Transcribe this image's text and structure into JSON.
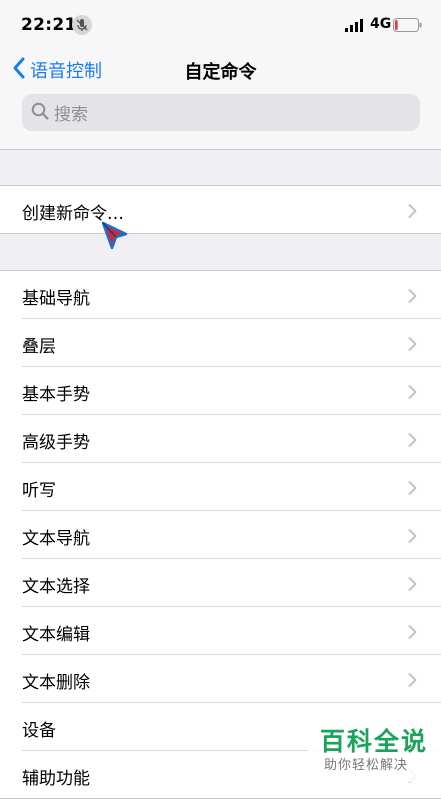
{
  "status_bar": {
    "time": "22:21",
    "network": "4G",
    "battery_level": 0.12,
    "battery_color": "#e0393e"
  },
  "nav": {
    "back_label": "语音控制",
    "title": "自定命令",
    "accent": "#1a7cf5"
  },
  "search": {
    "placeholder": "搜索"
  },
  "create_group": {
    "items": [
      {
        "label": "创建新命令…"
      }
    ]
  },
  "commands": {
    "items": [
      {
        "label": "基础导航"
      },
      {
        "label": "叠层"
      },
      {
        "label": "基本手势"
      },
      {
        "label": "高级手势"
      },
      {
        "label": "听写"
      },
      {
        "label": "文本导航"
      },
      {
        "label": "文本选择"
      },
      {
        "label": "文本编辑"
      },
      {
        "label": "文本删除"
      },
      {
        "label": "设备"
      },
      {
        "label": "辅助功能"
      }
    ]
  },
  "watermark": {
    "title": "百科全说",
    "subtitle": "助你轻松解决"
  }
}
